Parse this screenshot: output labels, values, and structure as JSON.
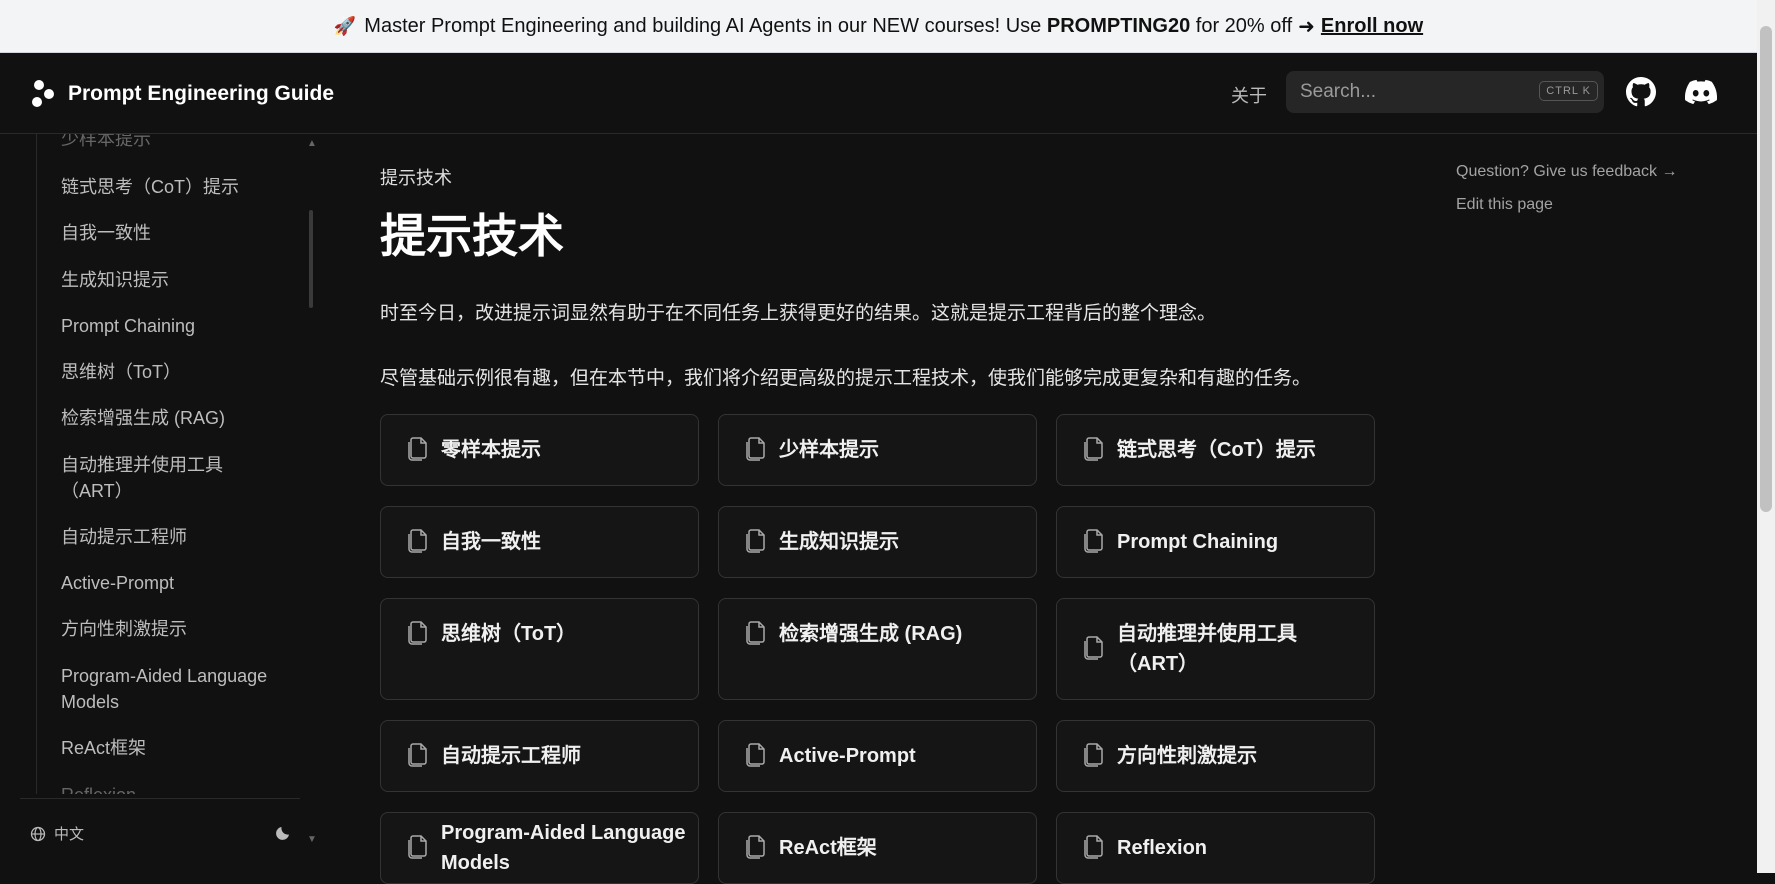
{
  "banner": {
    "prefix": "Master Prompt Engineering and building AI Agents in our NEW courses! Use",
    "code": "PROMPTING20",
    "suffix": "for 20% off",
    "arrow": "➜",
    "cta": "Enroll now"
  },
  "header": {
    "title": "Prompt Engineering Guide",
    "about": "关于",
    "search_placeholder": "Search...",
    "shortcut": "CTRL K"
  },
  "sidebar": {
    "items": [
      "少样本提示",
      "链式思考（CoT）提示",
      "自我一致性",
      "生成知识提示",
      "Prompt Chaining",
      "思维树（ToT）",
      "检索增强生成 (RAG)",
      "自动推理并使用工具（ART）",
      "自动提示工程师",
      "Active-Prompt",
      "方向性刺激提示",
      "Program-Aided Language Models",
      "ReAct框架",
      "Reflexion"
    ],
    "language": "中文"
  },
  "main": {
    "breadcrumb": "提示技术",
    "title": "提示技术",
    "paragraph1": "时至今日，改进提示词显然有助于在不同任务上获得更好的结果。这就是提示工程背后的整个理念。",
    "paragraph2": "尽管基础示例很有趣，但在本节中，我们将介绍更高级的提示工程技术，使我们能够完成更复杂和有趣的任务。",
    "cards": [
      "零样本提示",
      "少样本提示",
      "链式思考（CoT）提示",
      "自我一致性",
      "生成知识提示",
      "Prompt Chaining",
      "思维树（ToT）",
      "检索增强生成 (RAG)",
      "自动推理并使用工具（ART）",
      "自动提示工程师",
      "Active-Prompt",
      "方向性刺激提示",
      "Program-Aided Language Models",
      "ReAct框架",
      "Reflexion"
    ]
  },
  "toc": {
    "feedback": "Question? Give us feedback →",
    "edit": "Edit this page"
  }
}
